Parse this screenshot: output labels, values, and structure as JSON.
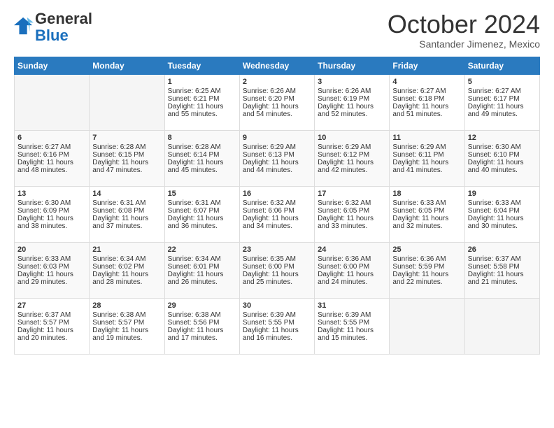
{
  "header": {
    "logo_line1": "General",
    "logo_line2": "Blue",
    "month": "October 2024",
    "location": "Santander Jimenez, Mexico"
  },
  "days_of_week": [
    "Sunday",
    "Monday",
    "Tuesday",
    "Wednesday",
    "Thursday",
    "Friday",
    "Saturday"
  ],
  "weeks": [
    [
      {
        "day": "",
        "content": ""
      },
      {
        "day": "",
        "content": ""
      },
      {
        "day": "1",
        "content": "Sunrise: 6:25 AM\nSunset: 6:21 PM\nDaylight: 11 hours and 55 minutes."
      },
      {
        "day": "2",
        "content": "Sunrise: 6:26 AM\nSunset: 6:20 PM\nDaylight: 11 hours and 54 minutes."
      },
      {
        "day": "3",
        "content": "Sunrise: 6:26 AM\nSunset: 6:19 PM\nDaylight: 11 hours and 52 minutes."
      },
      {
        "day": "4",
        "content": "Sunrise: 6:27 AM\nSunset: 6:18 PM\nDaylight: 11 hours and 51 minutes."
      },
      {
        "day": "5",
        "content": "Sunrise: 6:27 AM\nSunset: 6:17 PM\nDaylight: 11 hours and 49 minutes."
      }
    ],
    [
      {
        "day": "6",
        "content": "Sunrise: 6:27 AM\nSunset: 6:16 PM\nDaylight: 11 hours and 48 minutes."
      },
      {
        "day": "7",
        "content": "Sunrise: 6:28 AM\nSunset: 6:15 PM\nDaylight: 11 hours and 47 minutes."
      },
      {
        "day": "8",
        "content": "Sunrise: 6:28 AM\nSunset: 6:14 PM\nDaylight: 11 hours and 45 minutes."
      },
      {
        "day": "9",
        "content": "Sunrise: 6:29 AM\nSunset: 6:13 PM\nDaylight: 11 hours and 44 minutes."
      },
      {
        "day": "10",
        "content": "Sunrise: 6:29 AM\nSunset: 6:12 PM\nDaylight: 11 hours and 42 minutes."
      },
      {
        "day": "11",
        "content": "Sunrise: 6:29 AM\nSunset: 6:11 PM\nDaylight: 11 hours and 41 minutes."
      },
      {
        "day": "12",
        "content": "Sunrise: 6:30 AM\nSunset: 6:10 PM\nDaylight: 11 hours and 40 minutes."
      }
    ],
    [
      {
        "day": "13",
        "content": "Sunrise: 6:30 AM\nSunset: 6:09 PM\nDaylight: 11 hours and 38 minutes."
      },
      {
        "day": "14",
        "content": "Sunrise: 6:31 AM\nSunset: 6:08 PM\nDaylight: 11 hours and 37 minutes."
      },
      {
        "day": "15",
        "content": "Sunrise: 6:31 AM\nSunset: 6:07 PM\nDaylight: 11 hours and 36 minutes."
      },
      {
        "day": "16",
        "content": "Sunrise: 6:32 AM\nSunset: 6:06 PM\nDaylight: 11 hours and 34 minutes."
      },
      {
        "day": "17",
        "content": "Sunrise: 6:32 AM\nSunset: 6:05 PM\nDaylight: 11 hours and 33 minutes."
      },
      {
        "day": "18",
        "content": "Sunrise: 6:33 AM\nSunset: 6:05 PM\nDaylight: 11 hours and 32 minutes."
      },
      {
        "day": "19",
        "content": "Sunrise: 6:33 AM\nSunset: 6:04 PM\nDaylight: 11 hours and 30 minutes."
      }
    ],
    [
      {
        "day": "20",
        "content": "Sunrise: 6:33 AM\nSunset: 6:03 PM\nDaylight: 11 hours and 29 minutes."
      },
      {
        "day": "21",
        "content": "Sunrise: 6:34 AM\nSunset: 6:02 PM\nDaylight: 11 hours and 28 minutes."
      },
      {
        "day": "22",
        "content": "Sunrise: 6:34 AM\nSunset: 6:01 PM\nDaylight: 11 hours and 26 minutes."
      },
      {
        "day": "23",
        "content": "Sunrise: 6:35 AM\nSunset: 6:00 PM\nDaylight: 11 hours and 25 minutes."
      },
      {
        "day": "24",
        "content": "Sunrise: 6:36 AM\nSunset: 6:00 PM\nDaylight: 11 hours and 24 minutes."
      },
      {
        "day": "25",
        "content": "Sunrise: 6:36 AM\nSunset: 5:59 PM\nDaylight: 11 hours and 22 minutes."
      },
      {
        "day": "26",
        "content": "Sunrise: 6:37 AM\nSunset: 5:58 PM\nDaylight: 11 hours and 21 minutes."
      }
    ],
    [
      {
        "day": "27",
        "content": "Sunrise: 6:37 AM\nSunset: 5:57 PM\nDaylight: 11 hours and 20 minutes."
      },
      {
        "day": "28",
        "content": "Sunrise: 6:38 AM\nSunset: 5:57 PM\nDaylight: 11 hours and 19 minutes."
      },
      {
        "day": "29",
        "content": "Sunrise: 6:38 AM\nSunset: 5:56 PM\nDaylight: 11 hours and 17 minutes."
      },
      {
        "day": "30",
        "content": "Sunrise: 6:39 AM\nSunset: 5:55 PM\nDaylight: 11 hours and 16 minutes."
      },
      {
        "day": "31",
        "content": "Sunrise: 6:39 AM\nSunset: 5:55 PM\nDaylight: 11 hours and 15 minutes."
      },
      {
        "day": "",
        "content": ""
      },
      {
        "day": "",
        "content": ""
      }
    ]
  ]
}
